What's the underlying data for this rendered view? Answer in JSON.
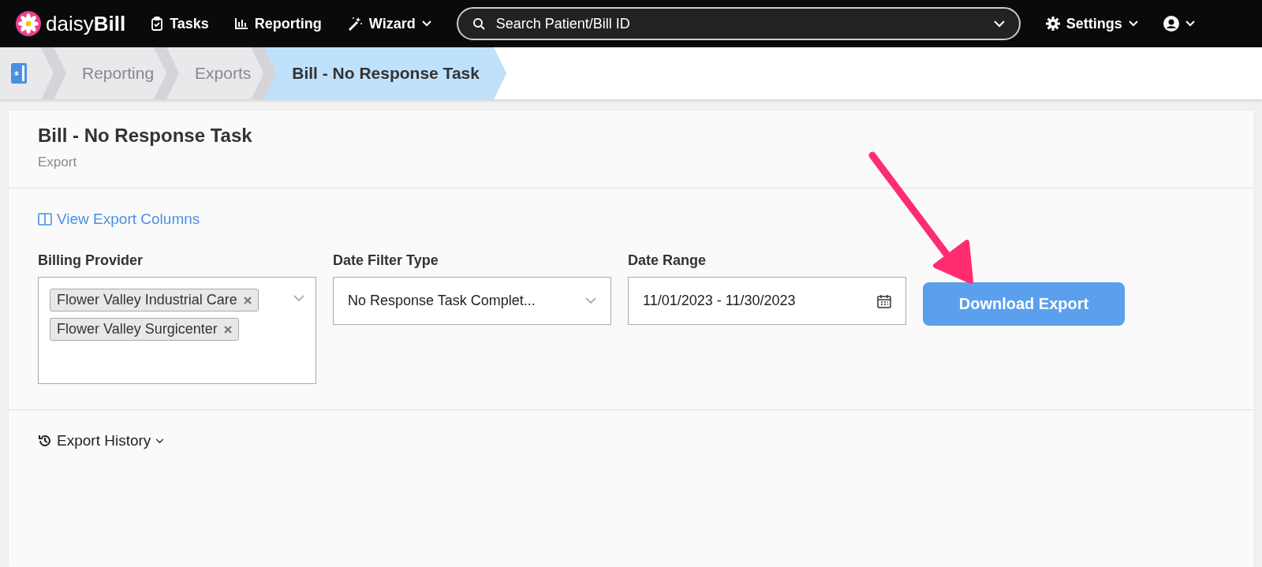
{
  "navbar": {
    "brand": {
      "light": "daisy",
      "bold": "Bill"
    },
    "items": [
      {
        "kind": "tasks",
        "label": "Tasks",
        "dropdown": false
      },
      {
        "kind": "reporting",
        "label": "Reporting",
        "dropdown": false
      },
      {
        "kind": "wizard",
        "label": "Wizard",
        "dropdown": true
      }
    ],
    "search": {
      "placeholder": "Search Patient/Bill ID"
    },
    "settings": {
      "label": "Settings"
    }
  },
  "breadcrumbs": [
    {
      "kind": "home",
      "selected": false
    },
    {
      "kind": "text",
      "label": "Reporting",
      "selected": false
    },
    {
      "kind": "text",
      "label": "Exports",
      "selected": false
    },
    {
      "kind": "text",
      "label": "Bill - No Response Task",
      "selected": true
    }
  ],
  "page": {
    "title": "Bill - No Response Task",
    "subtitle": "Export"
  },
  "link": "View Export Columns",
  "filters": [
    {
      "kind": "multi",
      "label": "Billing Provider",
      "tags": [
        "Flower Valley Industrial Care",
        "Flower Valley Surgicenter"
      ]
    },
    {
      "kind": "select",
      "label": "Date Filter Type",
      "value": "No Response Task Complet..."
    },
    {
      "kind": "date",
      "label": "Date Range",
      "value": "11/01/2023 - 11/30/2023"
    }
  ],
  "download_button": "Download Export",
  "history": "Export History"
}
